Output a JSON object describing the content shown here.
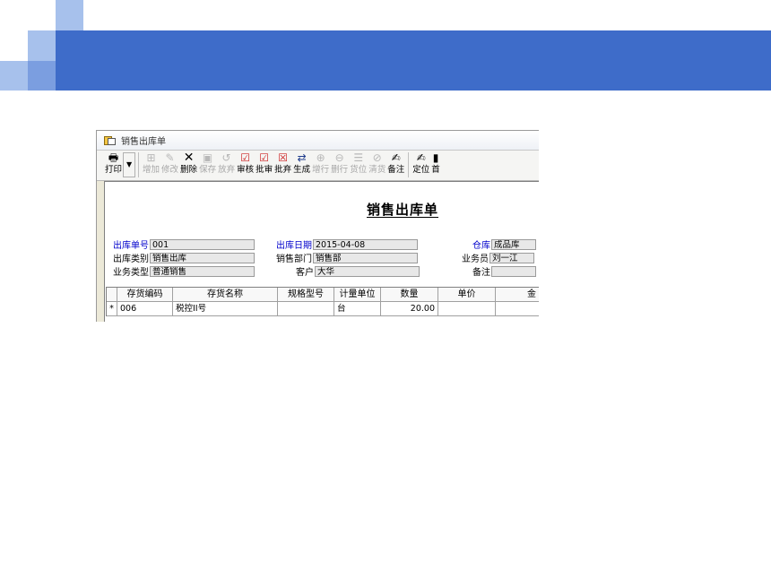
{
  "window": {
    "title": "销售出库单"
  },
  "toolbar": [
    {
      "label": "打印",
      "icon": "printer-icon",
      "enabled": true
    },
    {
      "label": "增加",
      "icon": "add-icon",
      "enabled": false
    },
    {
      "label": "修改",
      "icon": "edit-icon",
      "enabled": false
    },
    {
      "label": "删除",
      "icon": "delete-icon",
      "enabled": true
    },
    {
      "label": "保存",
      "icon": "save-icon",
      "enabled": false
    },
    {
      "label": "放弃",
      "icon": "discard-icon",
      "enabled": false
    },
    {
      "label": "审核",
      "icon": "audit-icon",
      "enabled": true
    },
    {
      "label": "批审",
      "icon": "batch-audit-icon",
      "enabled": true
    },
    {
      "label": "批弃",
      "icon": "batch-discard-icon",
      "enabled": true
    },
    {
      "label": "生成",
      "icon": "generate-icon",
      "enabled": true
    },
    {
      "label": "增行",
      "icon": "add-row-icon",
      "enabled": false
    },
    {
      "label": "删行",
      "icon": "delete-row-icon",
      "enabled": false
    },
    {
      "label": "货位",
      "icon": "location-icon",
      "enabled": false
    },
    {
      "label": "清货",
      "icon": "clear-icon",
      "enabled": false
    },
    {
      "label": "备注",
      "icon": "note-icon",
      "enabled": true
    },
    {
      "label": "定位",
      "icon": "locate-icon",
      "enabled": true
    },
    {
      "label": "首",
      "icon": "first-icon",
      "enabled": true
    }
  ],
  "form": {
    "title": "销售出库单",
    "fields": {
      "out_no": {
        "label": "出库单号",
        "value": "001"
      },
      "out_date": {
        "label": "出库日期",
        "value": "2015-04-08"
      },
      "warehouse": {
        "label": "仓库",
        "value": "成品库"
      },
      "out_type": {
        "label": "出库类别",
        "value": "销售出库"
      },
      "sales_dept": {
        "label": "销售部门",
        "value": "销售部"
      },
      "salesman": {
        "label": "业务员",
        "value": "刘一江"
      },
      "biz_type": {
        "label": "业务类型",
        "value": "普通销售"
      },
      "customer": {
        "label": "客户",
        "value": "大华"
      },
      "remark": {
        "label": "备注",
        "value": ""
      }
    }
  },
  "grid": {
    "columns": [
      "存货编码",
      "存货名称",
      "规格型号",
      "计量单位",
      "数量",
      "单价",
      "金"
    ],
    "rows": [
      {
        "marker": "*",
        "code": "006",
        "name": "税控II号",
        "spec": "",
        "unit": "台",
        "qty": "20.00",
        "price": "",
        "amount": ""
      }
    ]
  },
  "colors": {
    "banner": "#3e6cc9",
    "square_light": "#a7c1ec",
    "square_mid": "#7b9ee0",
    "label_blue": "#0000cc"
  }
}
